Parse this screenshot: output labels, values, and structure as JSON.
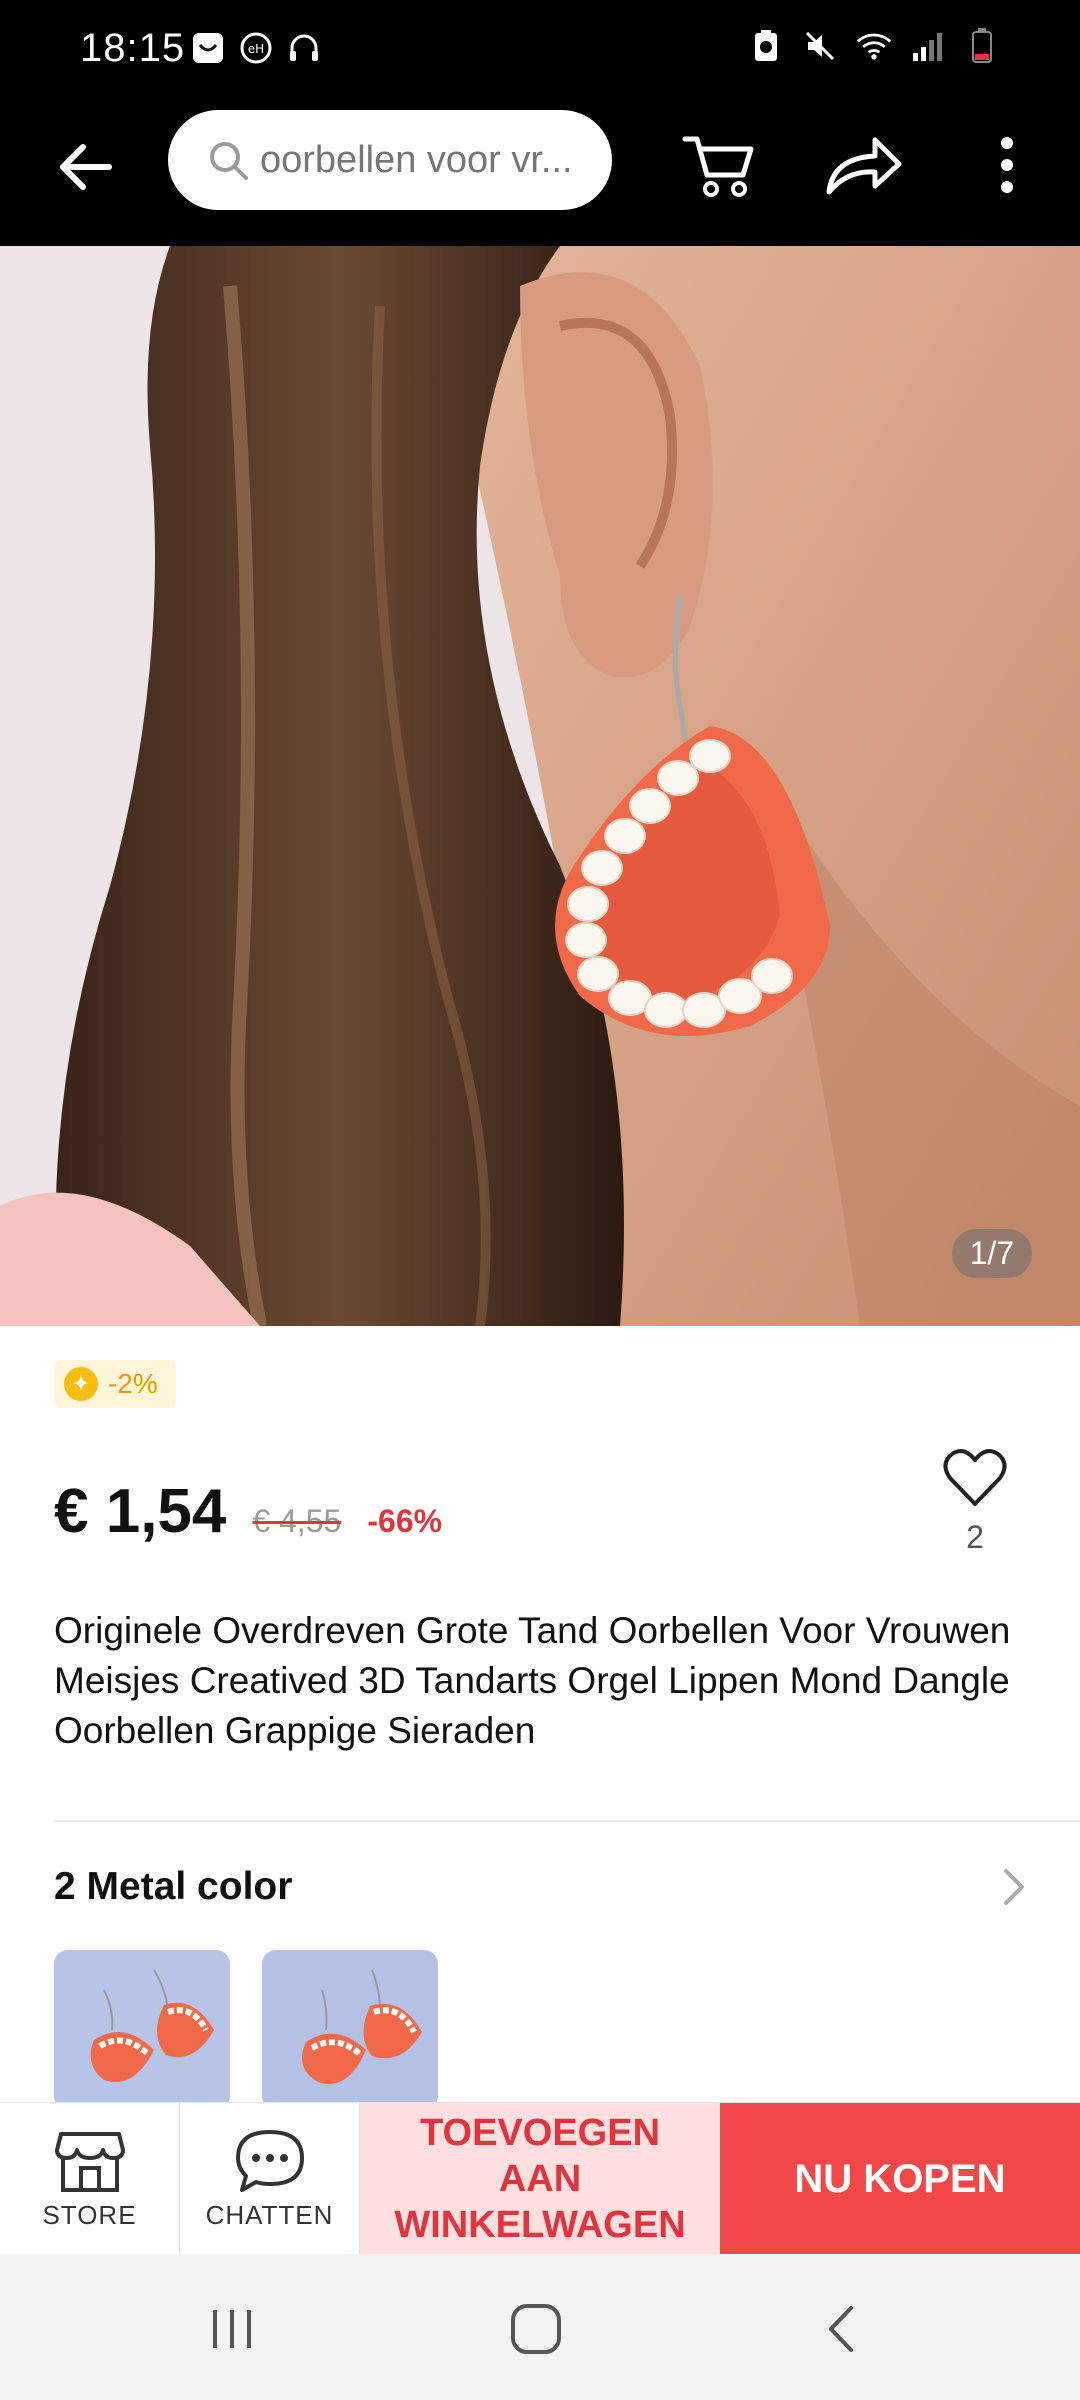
{
  "status_bar": {
    "time": "18:15",
    "left_icons": [
      "shop-notification-icon",
      "app-notification-icon",
      "headphones-icon"
    ],
    "right_icons": [
      "battery-saver-icon",
      "mute-icon",
      "wifi-icon",
      "signal-icon",
      "battery-low-icon"
    ]
  },
  "app_bar": {
    "search_placeholder": "oorbellen voor vr..."
  },
  "hero": {
    "counter": "1/7"
  },
  "product": {
    "coin_badge": "-2%",
    "price": "€ 1,54",
    "old_price": "€ 4,55",
    "discount": "-66%",
    "wishlist_count": "2",
    "title": "Originele Overdreven Grote Tand Oorbellen Voor Vrouwen Meisjes Creatived 3D Tandarts Orgel Lippen Mond Dangle Oorbellen Grappige Sieraden"
  },
  "variants": {
    "title": "2 Metal color",
    "count": 2
  },
  "action_bar": {
    "store_label": "STORE",
    "chat_label": "CHATTEN",
    "add_to_cart_label": "TOEVOEGEN AAN WINKELWAGEN",
    "buy_now_label": "NU KOPEN"
  },
  "colors": {
    "accent_red": "#f24749",
    "light_red": "#fde0df",
    "discount_red": "#e0353f",
    "coin_yellow": "#f5bd14"
  }
}
